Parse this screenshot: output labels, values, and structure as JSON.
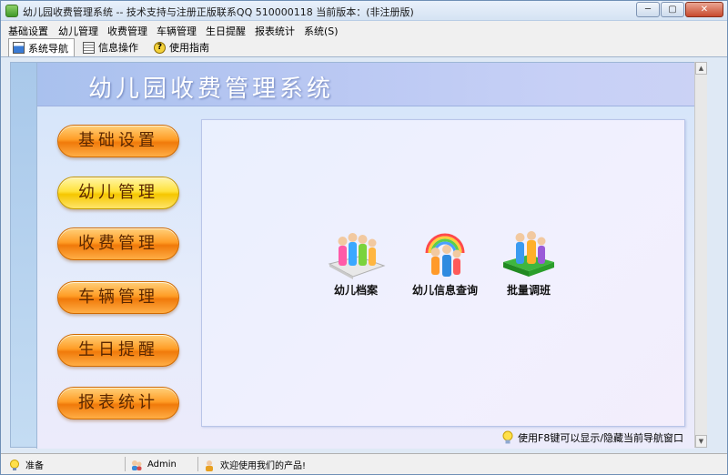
{
  "window": {
    "title": "幼儿园收费管理系统 -- 技术支持与注册正版联系QQ 510000118    当前版本：(非注册版)",
    "min_label": "─",
    "max_label": "▢",
    "close_label": "✕"
  },
  "menubar": {
    "items": [
      "基础设置",
      "幼儿管理",
      "收费管理",
      "车辆管理",
      "生日提醒",
      "报表统计",
      "系统(S)"
    ]
  },
  "toolbar": {
    "tabs": [
      "系统导航",
      "信息操作",
      "使用指南"
    ]
  },
  "header": {
    "title": "幼儿园收费管理系统"
  },
  "nav": {
    "buttons": [
      "基础设置",
      "幼儿管理",
      "收费管理",
      "车辆管理",
      "生日提醒",
      "报表统计"
    ],
    "selected": "幼儿管理"
  },
  "functions": {
    "items": [
      "幼儿档案",
      "幼儿信息查询",
      "批量调班"
    ]
  },
  "hint": {
    "text": "使用F8键可以显示/隐藏当前导航窗口"
  },
  "statusbar": {
    "ready": "准备",
    "user": "Admin",
    "message": "欢迎使用我们的产品!"
  },
  "colors": {
    "button_orange": "#ff9d26",
    "button_selected": "#ffe23a",
    "header_band": "#b8c7f2"
  }
}
